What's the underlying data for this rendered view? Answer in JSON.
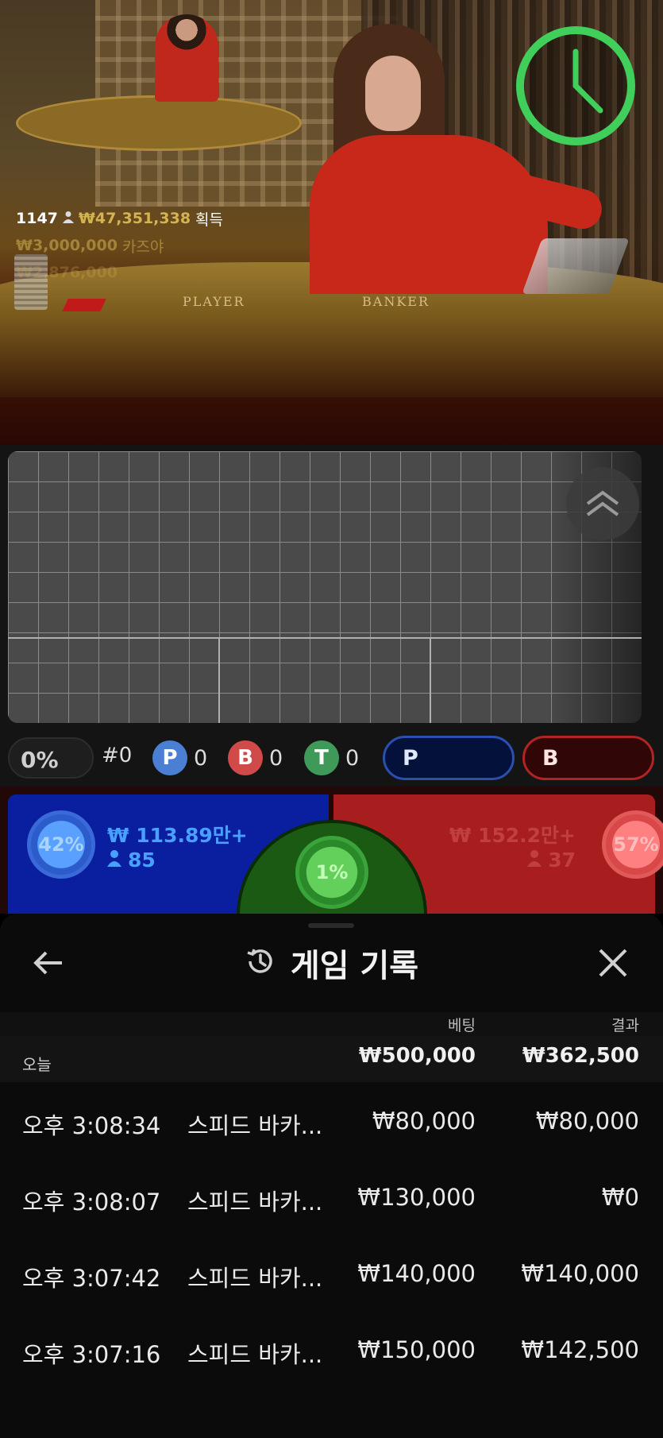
{
  "winners": [
    {
      "count": "1147",
      "amount": "₩47,351,338",
      "label": "획득"
    },
    {
      "amount": "₩3,000,000",
      "name": "카즈야"
    },
    {
      "amount": "₩2,876,000",
      "name": ""
    }
  ],
  "table_labels": {
    "player": "PLAYER",
    "banker": "BANKER"
  },
  "stats": {
    "percent": "0%",
    "game_number": "#0",
    "player": {
      "letter": "P",
      "count": "0",
      "color": "#4a7fd4"
    },
    "banker": {
      "letter": "B",
      "count": "0",
      "color": "#d04a4a"
    },
    "tie": {
      "letter": "T",
      "count": "0",
      "color": "#3f9a5a"
    },
    "predict_player": "P",
    "predict_banker": "B"
  },
  "bets": {
    "player": {
      "percent": "42%",
      "amount": "₩ 113.89만+",
      "players": "85"
    },
    "tie": {
      "percent": "1%"
    },
    "banker": {
      "percent": "57%",
      "amount": "₩ 152.2만+",
      "players": "37"
    }
  },
  "history": {
    "title": "게임 기록",
    "columns": {
      "bet": "베팅",
      "result": "결과"
    },
    "summary": {
      "label": "오늘",
      "bet": "₩500,000",
      "result": "₩362,500"
    },
    "rows": [
      {
        "time": "오후 3:08:34",
        "game": "스피드 바카...",
        "bet": "₩80,000",
        "result": "₩80,000"
      },
      {
        "time": "오후 3:08:07",
        "game": "스피드 바카...",
        "bet": "₩130,000",
        "result": "₩0"
      },
      {
        "time": "오후 3:07:42",
        "game": "스피드 바카...",
        "bet": "₩140,000",
        "result": "₩140,000"
      },
      {
        "time": "오후 3:07:16",
        "game": "스피드 바카...",
        "bet": "₩150,000",
        "result": "₩142,500"
      }
    ]
  },
  "icons": {
    "timer": "clock-icon",
    "expand": "chevron-up-double-icon",
    "back": "arrow-left-icon",
    "history": "history-icon",
    "close": "close-icon",
    "user": "user-icon"
  },
  "colors": {
    "timer_ring": "#3fcf5a",
    "player_blue": "#0a1ea0",
    "banker_red": "#a81e1e",
    "tie_green": "#2a8a2a"
  }
}
